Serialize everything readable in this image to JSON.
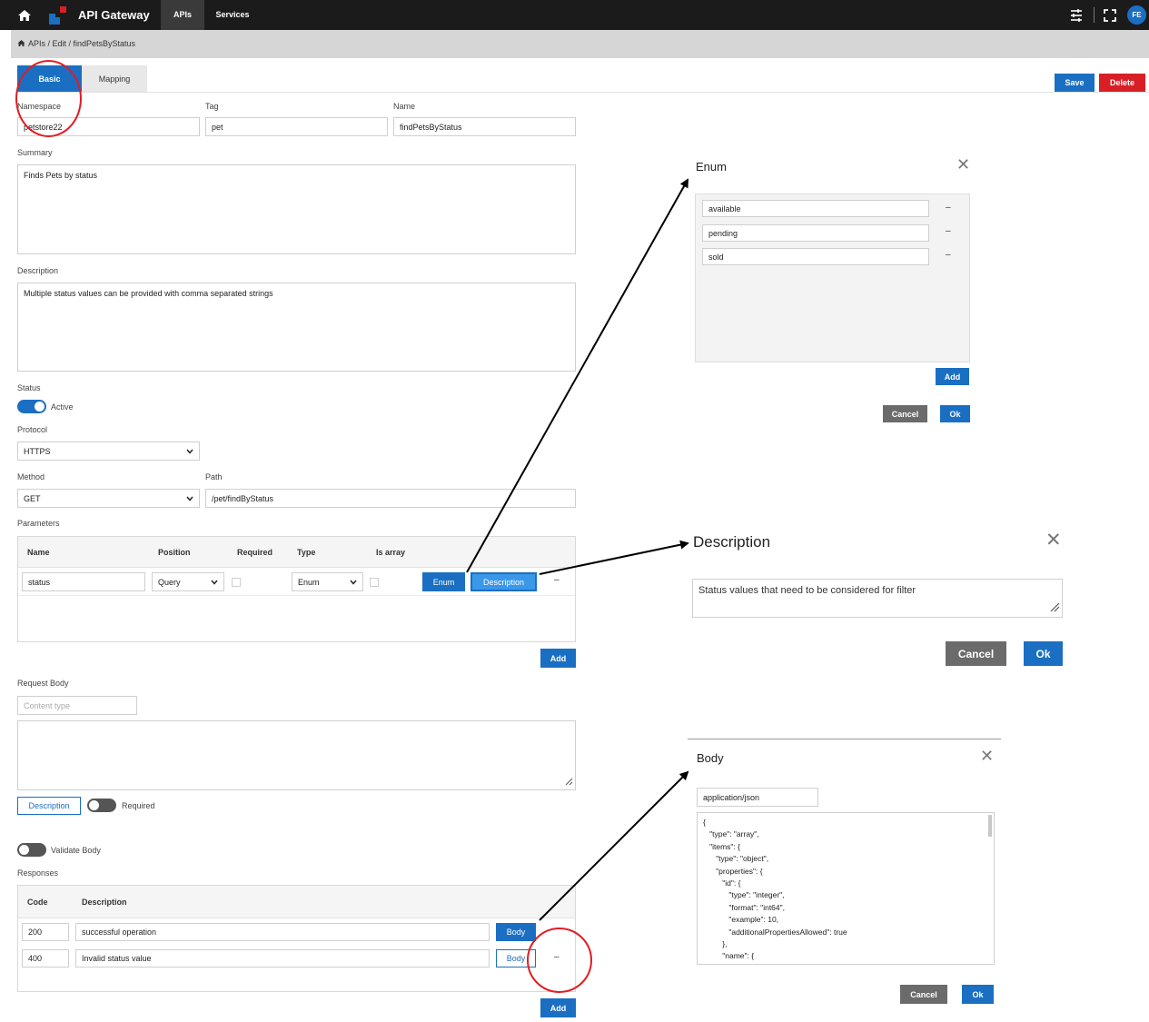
{
  "header": {
    "app_title": "API Gateway",
    "nav": [
      {
        "label": "APIs"
      },
      {
        "label": "Services"
      }
    ],
    "avatar_initials": "FE"
  },
  "breadcrumb": {
    "text": "APIs / Edit / findPetsByStatus"
  },
  "tabs": [
    {
      "label": "Basic"
    },
    {
      "label": "Mapping"
    }
  ],
  "actions": {
    "save": "Save",
    "delete": "Delete"
  },
  "form": {
    "namespace": {
      "label": "Namespace",
      "value": "petstore22"
    },
    "tag": {
      "label": "Tag",
      "value": "pet"
    },
    "name": {
      "label": "Name",
      "value": "findPetsByStatus"
    },
    "summary": {
      "label": "Summary",
      "value": "Finds Pets by status"
    },
    "description": {
      "label": "Description",
      "value": "Multiple status values can be provided with comma separated strings"
    },
    "status": {
      "label": "Status",
      "toggle_label": "Active",
      "on": true
    },
    "protocol": {
      "label": "Protocol",
      "value": "HTTPS"
    },
    "method": {
      "label": "Method",
      "value": "GET"
    },
    "path": {
      "label": "Path",
      "value": "/pet/findByStatus"
    }
  },
  "parameters": {
    "label": "Parameters",
    "columns": [
      "Name",
      "Position",
      "Required",
      "Type",
      "Is array"
    ],
    "rows": [
      {
        "name": "status",
        "position": "Query",
        "required": false,
        "type": "Enum",
        "is_array": false,
        "enum_button": "Enum",
        "description_button": "Description",
        "remove": "–"
      }
    ],
    "add_button": "Add"
  },
  "request_body": {
    "label": "Request Body",
    "content_type_placeholder": "Content type",
    "description_button": "Description",
    "required_label": "Required",
    "validate_label": "Validate Body"
  },
  "responses": {
    "label": "Responses",
    "columns": [
      "Code",
      "Description"
    ],
    "rows": [
      {
        "code": "200",
        "description": "successful operation",
        "body_button": "Body"
      },
      {
        "code": "400",
        "description": "Invalid status value",
        "body_button": "Body",
        "remove": "–"
      }
    ],
    "add_button": "Add"
  },
  "enum_dialog": {
    "title": "Enum",
    "items": [
      {
        "value": "available",
        "remove": "–"
      },
      {
        "value": "pending",
        "remove": "–"
      },
      {
        "value": "sold",
        "remove": "–"
      }
    ],
    "add_button": "Add",
    "cancel_button": "Cancel",
    "ok_button": "Ok"
  },
  "description_dialog": {
    "title": "Description",
    "value": "Status values that need to be considered for filter",
    "cancel_button": "Cancel",
    "ok_button": "Ok"
  },
  "body_dialog": {
    "title": "Body",
    "content_type": "application/json",
    "schema": "{\n   \"type\": \"array\",\n   \"items\": {\n      \"type\": \"object\",\n      \"properties\": {\n         \"id\": {\n            \"type\": \"integer\",\n            \"format\": \"int64\",\n            \"example\": 10,\n            \"additionalPropertiesAllowed\": true\n         },\n         \"name\": {",
    "cancel_button": "Cancel",
    "ok_button": "Ok"
  },
  "colors": {
    "primary": "#1a6fc2",
    "danger": "#d81f26",
    "topbar": "#1b1b1b",
    "annotation": "#e01c24"
  }
}
